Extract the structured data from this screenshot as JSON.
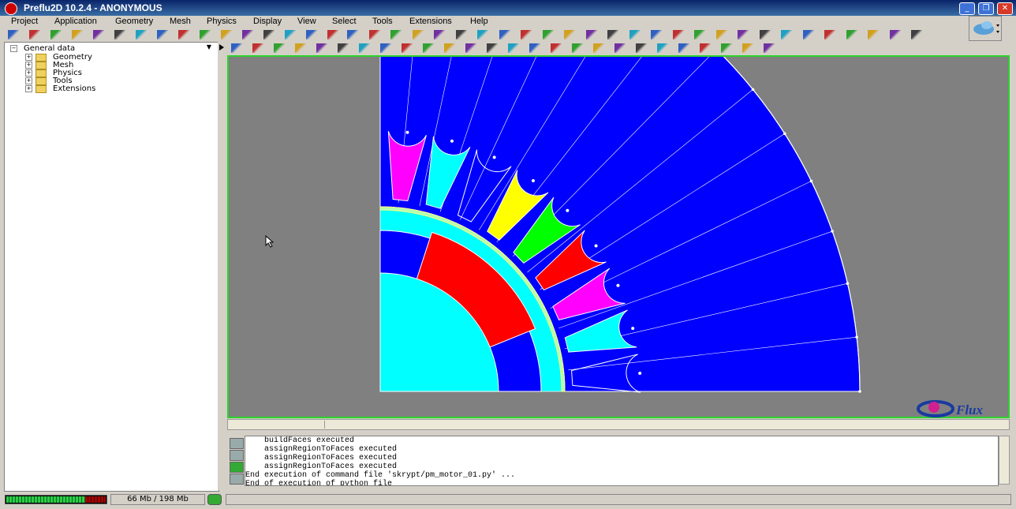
{
  "window": {
    "title": "Preflu2D 10.2.4 - ANONYMOUS"
  },
  "menu": [
    "Project",
    "Application",
    "Geometry",
    "Mesh",
    "Physics",
    "Display",
    "View",
    "Select",
    "Tools",
    "Extensions",
    "Help"
  ],
  "tree": {
    "root": "General data",
    "items": [
      "Geometry",
      "Mesh",
      "Physics",
      "Tools",
      "Extensions"
    ]
  },
  "console": {
    "lines": [
      "    buildFaces executed",
      "    assignRegionToFaces executed",
      "    assignRegionToFaces executed",
      "    assignRegionToFaces executed",
      "End execution of command file 'skrypt/pm_motor_01.py' ...",
      "End of execution of python file"
    ]
  },
  "status": {
    "memory": "66 Mb / 198 Mb",
    "memory_used_fraction": 0.33
  },
  "logo": {
    "text": "Flux"
  },
  "icons": [
    "app-icon",
    "minimize-icon",
    "restore-icon",
    "close-icon",
    "new-icon",
    "open-icon",
    "save-icon",
    "undo-icon",
    "redo-icon",
    "zoom-icon",
    "select-icon",
    "folder-icon",
    "expand-icon",
    "cursor-icon",
    "gc-icon"
  ],
  "colors": {
    "stator": "#0000ff",
    "rotor_shaft": "#00ffff",
    "magnet": "#ff0000",
    "coil_magenta": "#ff00ff",
    "coil_cyan": "#00ffff",
    "coil_yellow": "#ffff00",
    "coil_green": "#00ff00",
    "coil_red": "#ff0000",
    "background": "#808080",
    "viewport_border": "#2bd42b"
  }
}
